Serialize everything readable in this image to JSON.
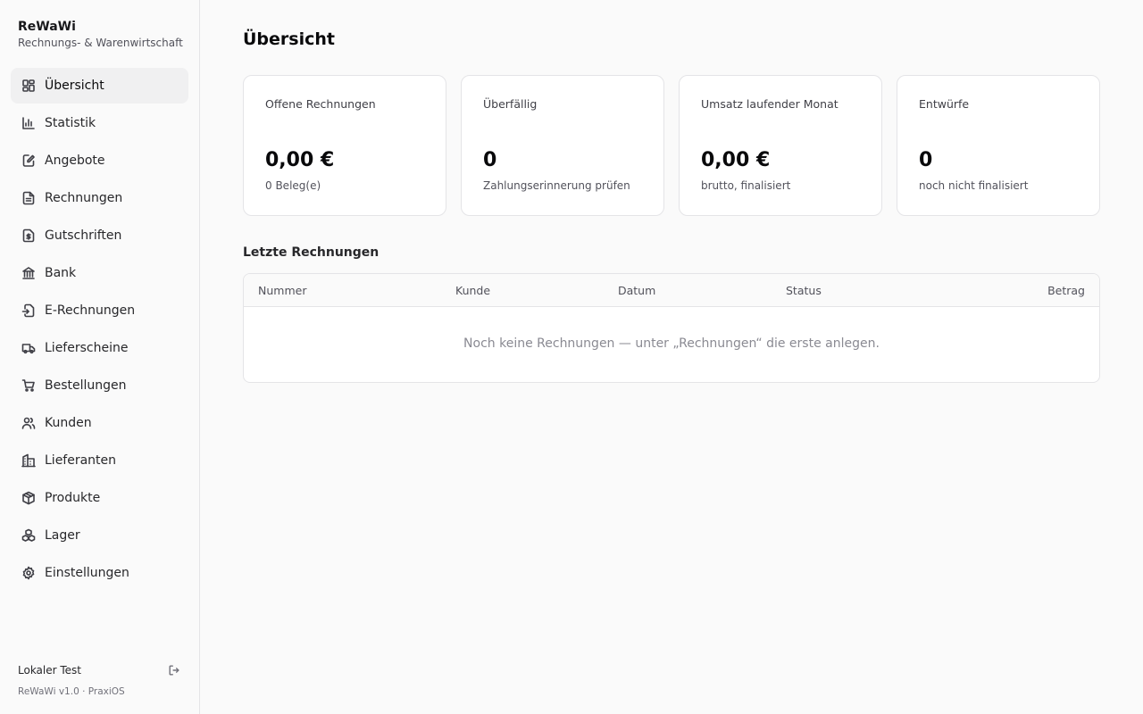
{
  "sidebar": {
    "brand_name": "ReWaWi",
    "brand_sub": "Rechnungs- & Warenwirtschaft",
    "items": [
      {
        "label": "Übersicht",
        "icon": "dashboard-icon"
      },
      {
        "label": "Statistik",
        "icon": "bar-chart-icon"
      },
      {
        "label": "Angebote",
        "icon": "edit-document-icon"
      },
      {
        "label": "Rechnungen",
        "icon": "document-icon"
      },
      {
        "label": "Gutschriften",
        "icon": "dollar-receipt-icon"
      },
      {
        "label": "Bank",
        "icon": "bank-icon"
      },
      {
        "label": "E-Rechnungen",
        "icon": "file-import-icon"
      },
      {
        "label": "Lieferscheine",
        "icon": "truck-icon"
      },
      {
        "label": "Bestellungen",
        "icon": "cart-icon"
      },
      {
        "label": "Kunden",
        "icon": "users-icon"
      },
      {
        "label": "Lieferanten",
        "icon": "building-icon"
      },
      {
        "label": "Produkte",
        "icon": "package-icon"
      },
      {
        "label": "Lager",
        "icon": "boxes-icon"
      },
      {
        "label": "Einstellungen",
        "icon": "gear-icon"
      }
    ],
    "user": "Lokaler Test",
    "version": "ReWaWi v1.0 · PraxiOS"
  },
  "main": {
    "title": "Übersicht",
    "cards": [
      {
        "label": "Offene Rechnungen",
        "value": "0,00 €",
        "sub": "0 Beleg(e)"
      },
      {
        "label": "Überfällig",
        "value": "0",
        "sub": "Zahlungserinnerung prüfen"
      },
      {
        "label": "Umsatz laufender Monat",
        "value": "0,00 €",
        "sub": "brutto, finalisiert"
      },
      {
        "label": "Entwürfe",
        "value": "0",
        "sub": "noch nicht finalisiert"
      }
    ],
    "recent_title": "Letzte Rechnungen",
    "table": {
      "columns": [
        "Nummer",
        "Kunde",
        "Datum",
        "Status",
        "Betrag"
      ],
      "empty": "Noch keine Rechnungen — unter „Rechnungen“ die erste anlegen."
    }
  }
}
